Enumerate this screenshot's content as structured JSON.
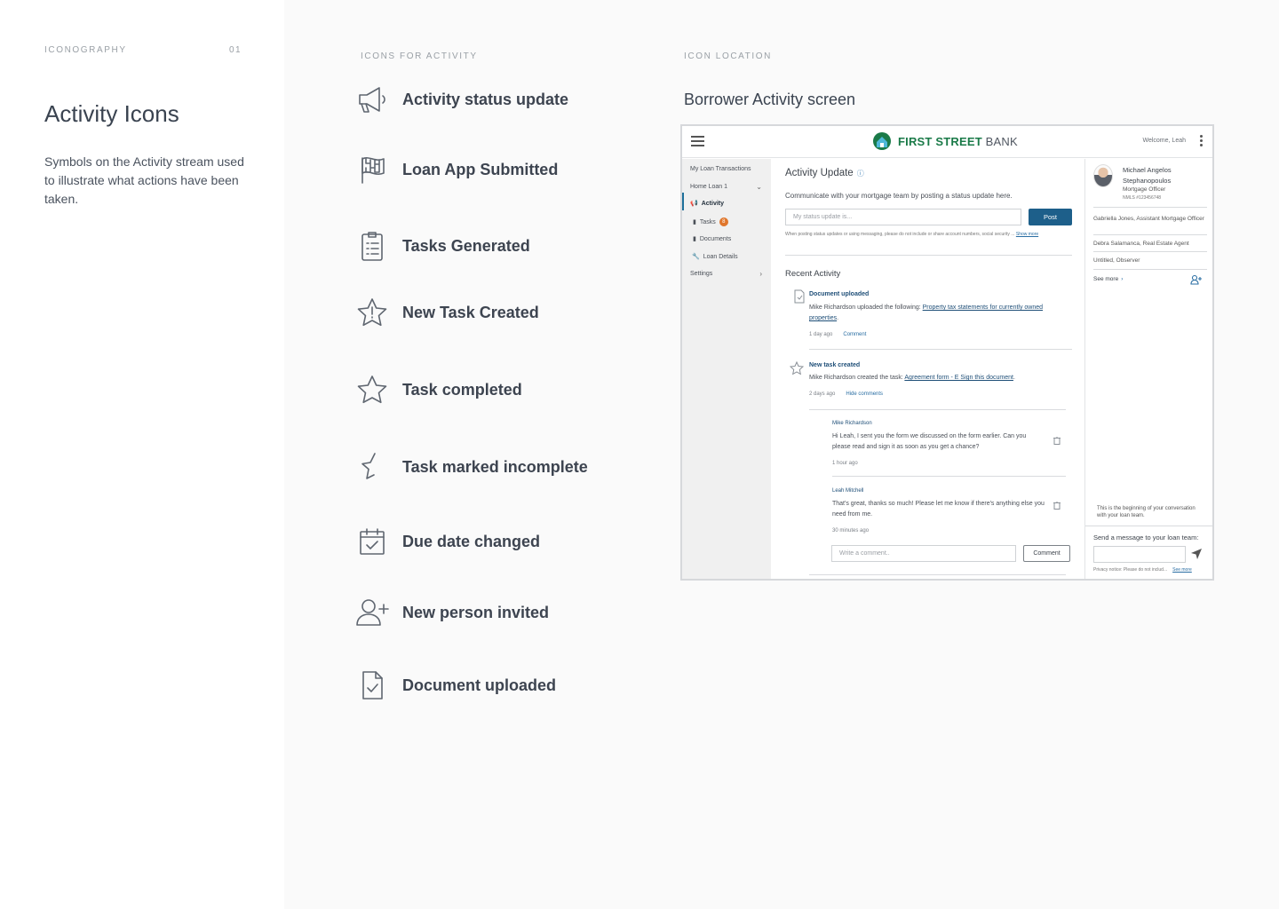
{
  "left": {
    "eyebrow": "ICONOGRAPHY",
    "page_number": "01",
    "title": "Activity Icons",
    "description": "Symbols on the Activity stream used to illustrate what actions have been taken."
  },
  "icons_section": {
    "eyebrow": "ICONS FOR ACTIVITY",
    "items": [
      {
        "icon": "megaphone-icon",
        "label": "Activity status update"
      },
      {
        "icon": "checkered-flag-icon",
        "label": "Loan App Submitted"
      },
      {
        "icon": "clipboard-list-icon",
        "label": "Tasks Generated"
      },
      {
        "icon": "star-exclamation-icon",
        "label": "New Task Created"
      },
      {
        "icon": "star-icon",
        "label": "Task completed"
      },
      {
        "icon": "broken-star-icon",
        "label": "Task marked incomplete"
      },
      {
        "icon": "calendar-check-icon",
        "label": "Due date changed"
      },
      {
        "icon": "person-add-icon",
        "label": "New person invited"
      },
      {
        "icon": "document-check-icon",
        "label": "Document uploaded"
      }
    ]
  },
  "location_section": {
    "eyebrow": "ICON LOCATION",
    "title": "Borrower Activity screen"
  },
  "mock": {
    "brand_bold": "FIRST STREET",
    "brand_thin": "BANK",
    "brand_color": "#1a7a48",
    "welcome": "Welcome, Leah",
    "sidebar": {
      "transactions": "My Loan Transactions",
      "loan": "Home Loan 1",
      "activity": "Activity",
      "tasks": "Tasks",
      "tasks_badge": "8",
      "documents": "Documents",
      "loan_details": "Loan Details",
      "settings": "Settings"
    },
    "main": {
      "title": "Activity Update",
      "subtitle": "Communicate with your mortgage team by posting a status update here.",
      "status_placeholder": "My status update is...",
      "post_label": "Post",
      "hint": "When posting status updates or using messaging, please do not include or share account numbers, social security ...",
      "show_more": "Show more",
      "recent_title": "Recent Activity",
      "activity1": {
        "title": "Document uploaded",
        "text_prefix": "Mike Richardson uploaded the following: ",
        "text_link": "Property tax statements for currently owned properties",
        "text_suffix": ".",
        "time": "1 day ago",
        "action": "Comment"
      },
      "activity2": {
        "title": "New task created",
        "text_prefix": "Mike Richardson created the task: ",
        "text_link": "Agreement form - E Sign this document",
        "text_suffix": ".",
        "time": "2 days ago",
        "action": "Hide comments"
      },
      "comment1": {
        "name": "Mike Richardson",
        "text": "Hi Leah, I sent you the form we discussed on the form earlier. Can you please read and sign it as soon as you get a chance?",
        "time": "1 hour ago"
      },
      "comment2": {
        "name": "Leah Mitchell",
        "text": "That's great, thanks so much! Please let me know if there's anything else you need from me.",
        "time": "30 minutes ago"
      },
      "comment_placeholder": "Write a comment..",
      "comment_button": "Comment"
    },
    "right": {
      "officer_name": "Michael Angelos Stephanopoulos",
      "officer_role": "Mortgage Officer",
      "officer_nmls": "NMLS #123456748",
      "team": [
        "Gabriella Jones, Assistant Mortgage Officer",
        "Debra Salamanca, Real Estate Agent",
        "Untitled, Observer"
      ],
      "see_more": "See more",
      "conversation_start": "This is the beginning of your conversation with your loan team.",
      "message_label": "Send a message to your loan team:",
      "privacy": "Privacy notice: Please do not includ...",
      "privacy_link": "See more"
    }
  }
}
